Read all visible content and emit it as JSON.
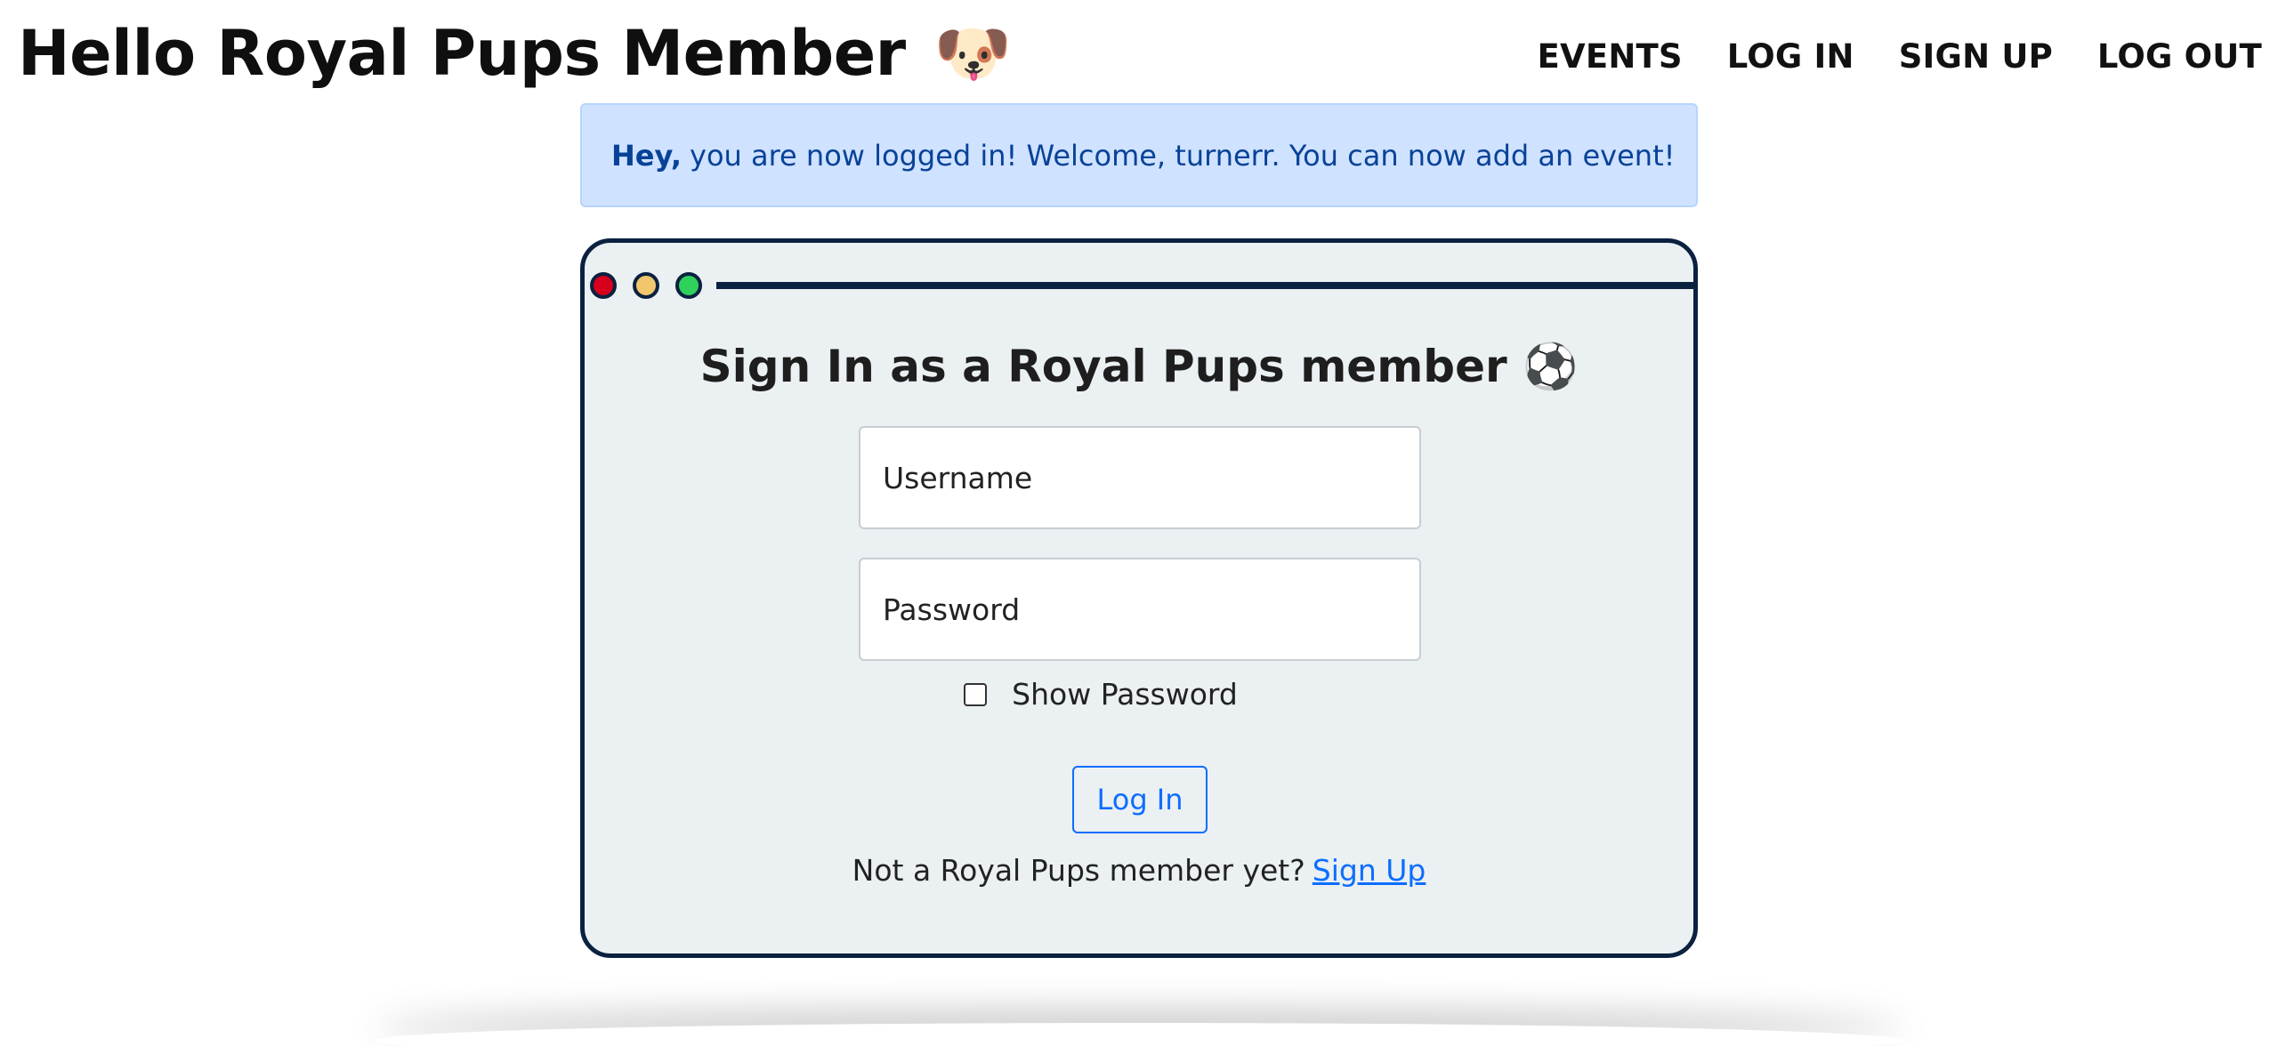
{
  "header": {
    "title": "Hello Royal Pups Member",
    "title_emoji": "🐶",
    "nav": [
      "EVENTS",
      "LOG IN",
      "SIGN UP",
      "LOG OUT"
    ]
  },
  "alert": {
    "strong": "Hey,",
    "message": "you are now logged in! Welcome, turnerr. You can now add an event!"
  },
  "login_form": {
    "title": "Sign In as a Royal Pups member ⚽",
    "username_placeholder": "Username",
    "password_placeholder": "Password",
    "show_password_label": "Show Password",
    "show_password_checked": false,
    "submit_label": "Log In",
    "signup_prompt": "Not a Royal Pups member yet?",
    "signup_link": "Sign Up"
  },
  "colors": {
    "window_border": "#0b2140",
    "window_bg": "#ebf0f3",
    "alert_bg": "#cfe2ff",
    "alert_text": "#084298",
    "primary": "#0d6efd",
    "dot_red": "#d6001c",
    "dot_yellow": "#f2c66d",
    "dot_green": "#2fd15a"
  },
  "icons": {
    "title_icon": "dog-face-icon",
    "form_title_icon": "soccer-ball-icon"
  }
}
